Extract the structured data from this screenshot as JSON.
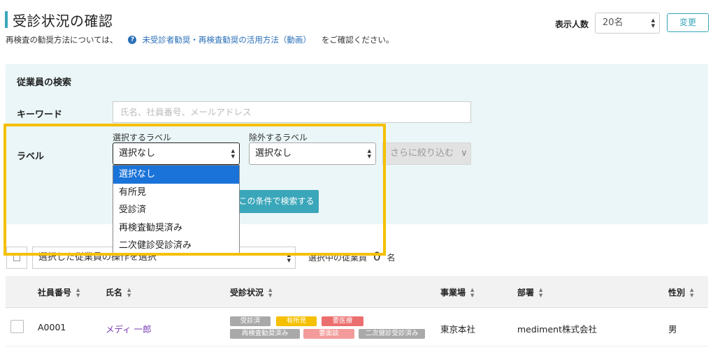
{
  "header": {
    "title": "受診状況の確認",
    "note_prefix": "再検査の勧奨方法については、",
    "help_link": "未受診者勧奨・再検査勧奨の活用方法（動画）",
    "note_suffix": "をご確認ください。",
    "display_count_label": "表示人数",
    "display_count_value": "20名",
    "change_button": "変更"
  },
  "search": {
    "panel_title": "従業員の検索",
    "keyword_label": "キーワード",
    "keyword_placeholder": "氏名、社員番号、メールアドレス",
    "label_label": "ラベル",
    "include_caption": "選択するラベル",
    "include_value": "選択なし",
    "exclude_caption": "除外するラベル",
    "exclude_value": "選択なし",
    "narrow_button": "さらに絞り込む",
    "search_button": "この条件で検索する",
    "dropdown_options": [
      "選択なし",
      "有所見",
      "受診済",
      "再検査勧奨済み",
      "二次健診受診済み"
    ]
  },
  "bulk": {
    "action_placeholder": "選択した従業員の操作を選択",
    "selected_prefix": "選択中の従業員",
    "selected_count": "0",
    "selected_suffix": "名"
  },
  "table": {
    "headers": {
      "employee_no": "社員番号",
      "name": "氏名",
      "status": "受診状況",
      "office": "事業場",
      "department": "部署",
      "gender": "性別"
    },
    "rows": [
      {
        "employee_no": "A0001",
        "name": "メディ 一郎",
        "tags": [
          {
            "text": "受診済",
            "color": "#a9a9a9"
          },
          {
            "text": "有所見",
            "color": "#f5c000"
          },
          {
            "text": "要医療",
            "color": "#ec6f6f"
          },
          {
            "text": "再検査勧奨済み",
            "color": "#a9a9a9"
          },
          {
            "text": "要面談",
            "color": "#f39a9a"
          },
          {
            "text": "二次健診受診済み",
            "color": "#a9a9a9"
          }
        ],
        "office": "東京本社",
        "department": "mediment株式会社",
        "gender": "男"
      }
    ]
  },
  "colors": {
    "accent": "#3aa6b9",
    "highlight": "#f5c000",
    "dropdown_selected": "#1a73d9"
  }
}
